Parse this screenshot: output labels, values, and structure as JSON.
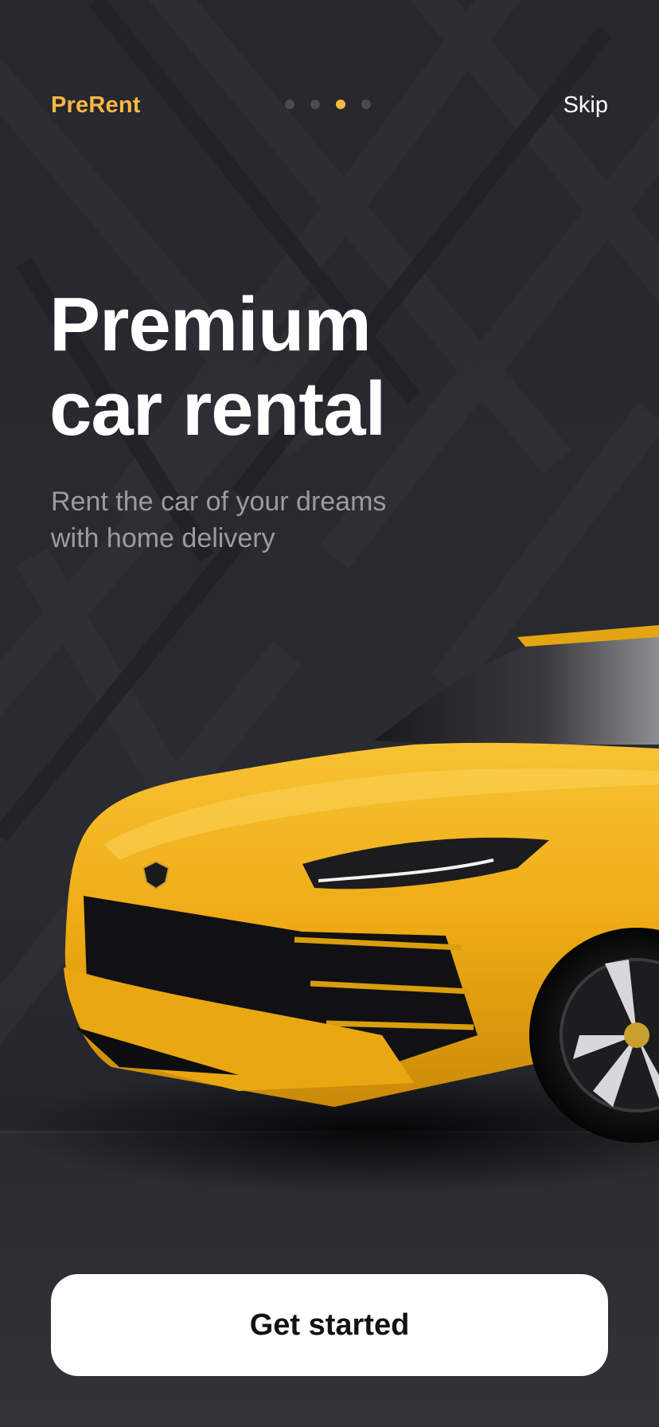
{
  "header": {
    "brand": "PreRent",
    "skip_label": "Skip",
    "pagination": {
      "total": 4,
      "active_index": 2
    }
  },
  "hero": {
    "headline_line1": "Premium",
    "headline_line2": "car rental",
    "subtitle_line1": "Rent the car of your dreams",
    "subtitle_line2": "with home delivery"
  },
  "cta": {
    "label": "Get started"
  },
  "colors": {
    "background": "#24252a",
    "accent": "#f5b941",
    "car_yellow": "#f2b21b",
    "button_bg": "#ffffff",
    "button_text": "#111214",
    "subtitle_text": "#9b9ca2"
  },
  "icons": [
    "lamborghini-emblem",
    "car-image"
  ]
}
